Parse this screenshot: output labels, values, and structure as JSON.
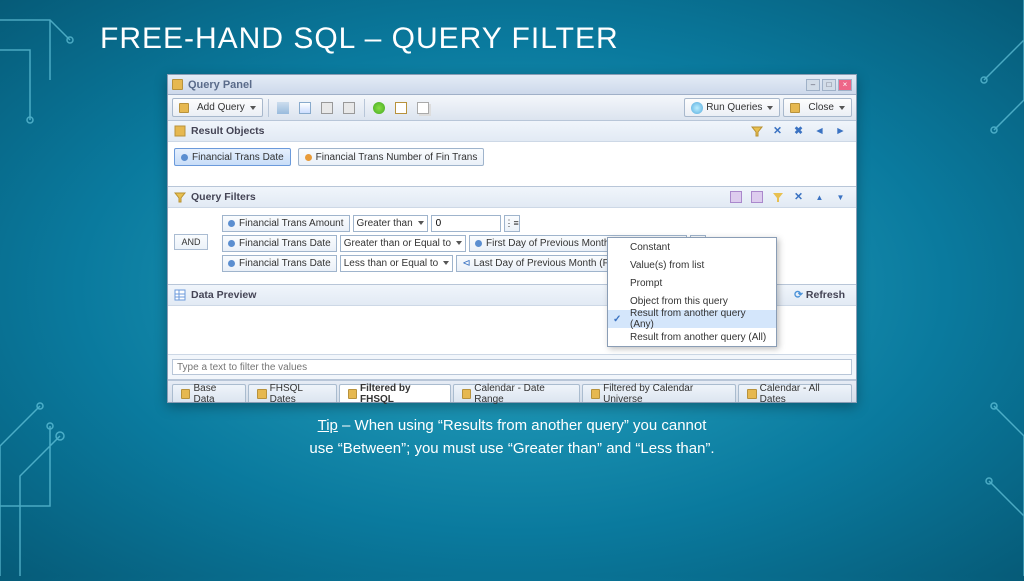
{
  "slide": {
    "title": "FREE-HAND SQL – QUERY FILTER",
    "tip_label": "Tip",
    "tip_text1": " – When using “Results from another query” you cannot",
    "tip_text2": "use “Between”; you must use “Greater than” and “Less than”."
  },
  "window": {
    "title": "Query Panel",
    "toolbar": {
      "add_query": "Add Query",
      "run_queries": "Run Queries",
      "close": "Close"
    }
  },
  "sections": {
    "result_objects": "Result Objects",
    "query_filters": "Query Filters",
    "data_preview": "Data Preview",
    "refresh": "Refresh"
  },
  "result_objects": {
    "items": [
      {
        "name": "Financial Trans Date",
        "kind": "dim"
      },
      {
        "name": "Financial Trans Number of Fin Trans",
        "kind": "meas"
      }
    ]
  },
  "filters": {
    "connector": "AND",
    "rows": [
      {
        "field": "Financial Trans Amount",
        "op": "Greater than",
        "val": "0",
        "val_type": "input"
      },
      {
        "field": "Financial Trans Date",
        "op": "Greater than or Equal to",
        "val": "First Day of Previous Month (FHSQL Dates)",
        "val_type": "obj"
      },
      {
        "field": "Financial Trans Date",
        "op": "Less than or Equal to",
        "val": "Last Day of Previous Month (FHSQL Dates)",
        "val_type": "obj"
      }
    ]
  },
  "menu": {
    "items": [
      "Constant",
      "Value(s) from list",
      "Prompt",
      "Object from this query",
      "Result from another query (Any)",
      "Result from another query (All)"
    ],
    "selected": 4
  },
  "preview": {
    "placeholder": "Type a text to filter the values"
  },
  "tabs": [
    "Base Data",
    "FHSQL Dates",
    "Filtered by FHSQL",
    "Calendar - Date Range",
    "Filtered by Calendar Universe",
    "Calendar - All Dates"
  ],
  "active_tab": 2
}
